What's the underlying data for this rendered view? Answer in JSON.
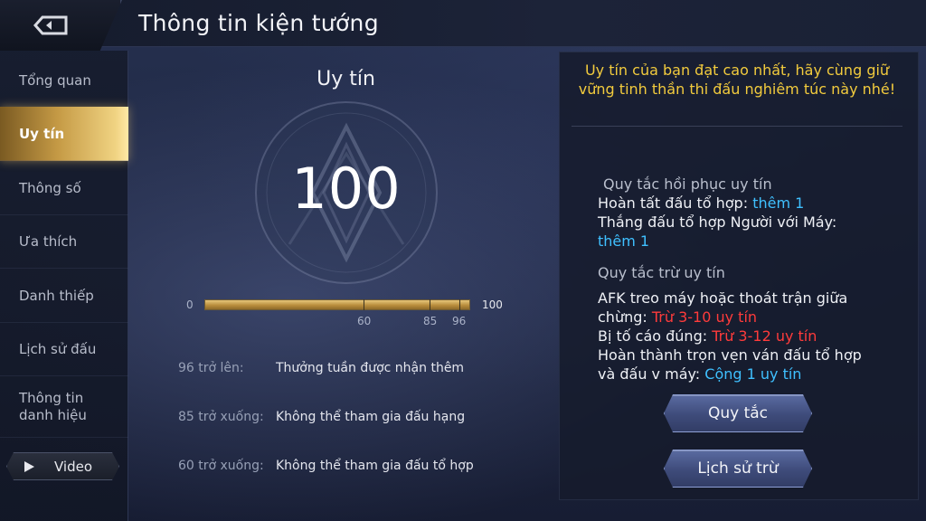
{
  "header": {
    "title": "Thông tin kiện tướng",
    "back_icon": "back-arrow-icon"
  },
  "sidebar": {
    "items": [
      {
        "label": "Tổng quan",
        "active": false
      },
      {
        "label": "Uy tín",
        "active": true
      },
      {
        "label": "Thông số",
        "active": false
      },
      {
        "label": "Ưa thích",
        "active": false
      },
      {
        "label": "Danh thiếp",
        "active": false
      },
      {
        "label": "Lịch sử đấu",
        "active": false
      },
      {
        "label_line1": "Thông tin",
        "label_line2": "danh hiệu",
        "active": false
      }
    ],
    "video_label": "Video"
  },
  "reputation": {
    "title": "Uy tín",
    "score": "100",
    "progress_value": 100,
    "bar_min": "0",
    "bar_max": "100",
    "thresholds": [
      "60",
      "85",
      "96"
    ],
    "rules": [
      {
        "condition": "96 trở lên:",
        "description": "Thưởng tuần được nhận thêm"
      },
      {
        "condition": "85 trở xuống:",
        "description": "Không thể tham gia đấu hạng"
      },
      {
        "condition": "60 trở xuống:",
        "description": "Không thể tham gia đấu tổ hợp"
      }
    ]
  },
  "panel": {
    "notice": "Uy tín của bạn đạt cao nhất, hãy cùng giữ vững tinh thần thi đấu nghiêm túc này nhé!",
    "recovery": {
      "heading": "Quy tắc hồi phục uy tín",
      "line1_text": "Hoàn tất đấu tổ hợp: ",
      "line1_value": "thêm 1",
      "line2_text": "Thắng đấu tổ hợp Người với Máy:",
      "line2_value": "thêm 1"
    },
    "deduction": {
      "heading": "Quy tắc trừ uy tín",
      "line1_text_a": "AFK treo máy hoặc thoát trận giữa",
      "line1_text_b": "chừng: ",
      "line1_value": "Trừ 3-10 uy tín",
      "line2_text": "Bị tố cáo đúng: ",
      "line2_value": "Trừ 3-12 uy tín",
      "line3_text_a": "Hoàn thành trọn vẹn ván đấu tổ hợp",
      "line3_text_b": "và đấu v máy: ",
      "line3_value": "Cộng 1 uy tín"
    },
    "rules_button": "Quy tắc",
    "history_button": "Lịch sử trừ"
  },
  "colors": {
    "accent_gold": "#f2cb3d",
    "cyan": "#3fc0ff",
    "red": "#ff3b3b"
  }
}
